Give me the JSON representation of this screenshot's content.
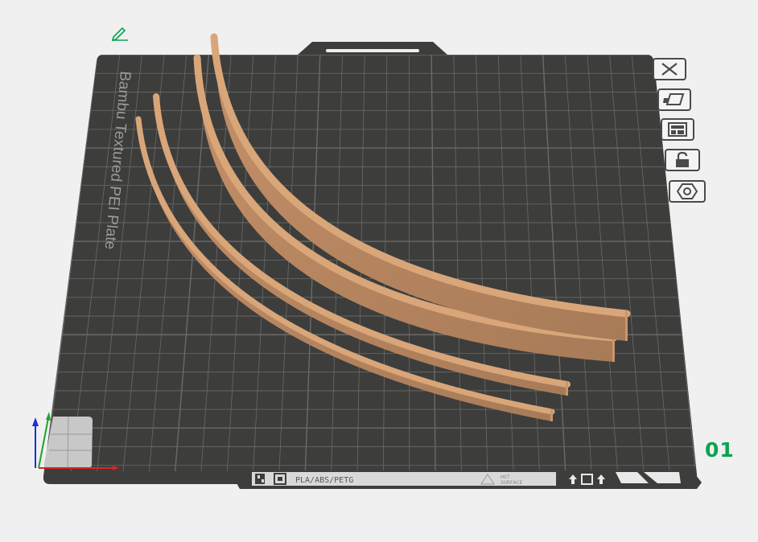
{
  "plate": {
    "name": "Bambu Textured PEI Plate",
    "number": "01",
    "filament_label": "PLA/ABS/PETG",
    "warning_label_line1": "HOT",
    "warning_label_line2": "SURFACE"
  },
  "toolbar": {
    "buttons": [
      {
        "name": "remove-plate-button",
        "icon": "close-icon"
      },
      {
        "name": "auto-orient-button",
        "icon": "orient-icon"
      },
      {
        "name": "arrange-button",
        "icon": "arrange-icon"
      },
      {
        "name": "lock-plate-button",
        "icon": "unlock-icon"
      },
      {
        "name": "plate-settings-button",
        "icon": "settings-hex-icon"
      }
    ]
  },
  "colors": {
    "background": "#f0f0f0",
    "bed": "#3d3d3c",
    "grid": "#6a6a68",
    "model": "#d9a679",
    "accent": "#0aa34f",
    "axis_x": "#e0231f",
    "axis_y": "#1fa32a",
    "axis_z": "#1d2fd6"
  }
}
